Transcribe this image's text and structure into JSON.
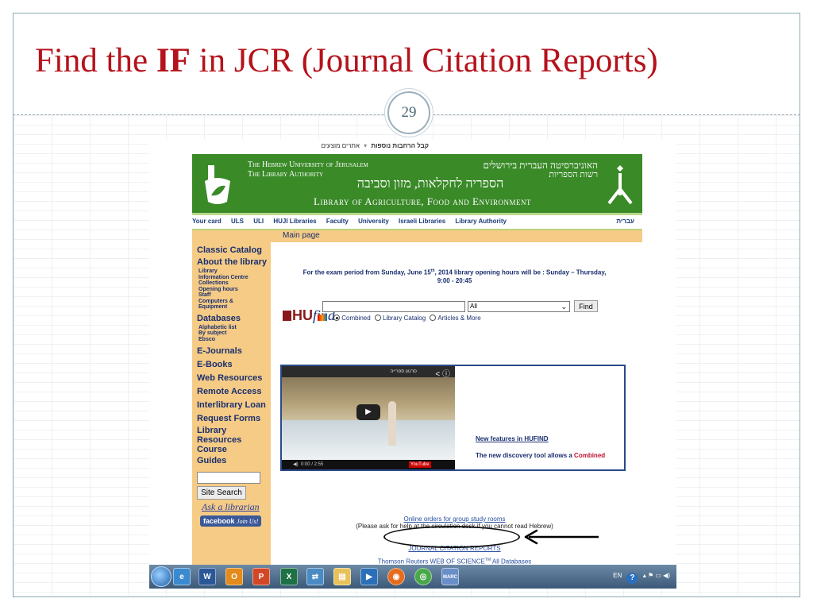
{
  "slide": {
    "title_prefix": "Find the ",
    "title_bold": "IF",
    "title_suffix": " in JCR (Journal Citation Reports)",
    "page_number": "29",
    "accent_color": "#b5121b"
  },
  "browser": {
    "favorites_bar": {
      "item1": "קבל הרחבות נוספות",
      "item2": "אתרים מוצעים"
    }
  },
  "site": {
    "banner": {
      "en_line1": "The Hebrew University of Jerusalem",
      "en_line2": "The Library Authority",
      "he_line1": "האוניברסיטה העברית בירושלים",
      "he_line2": "רשות הספריות",
      "he_line3": "הספריה לחקלאות, מזון וסביבה",
      "en_line3": "Library of Agriculture, Food and Environment",
      "color": "#3a8a28"
    },
    "topnav": {
      "items": [
        "Your card",
        "ULS",
        "ULI",
        "HUJI Libraries",
        "Faculty",
        "University",
        "Israeli Libraries",
        "Library Authority"
      ],
      "hebrew": "עברית"
    },
    "main_header": "Main page",
    "sidebar": {
      "classic_catalog": "Classic Catalog",
      "about": "About the library",
      "about_sub": [
        "Library",
        "Information Centre",
        "Collections",
        "Opening hours",
        "Staff",
        "Computers &",
        "Equipment"
      ],
      "databases": "Databases",
      "databases_sub": [
        "Alphabetic list",
        "By subject",
        "Ebsco"
      ],
      "ejournals": "E-Journals",
      "ebooks": "E-Books",
      "web_resources": "Web Resources",
      "remote_access": "Remote Access",
      "interlibrary_loan": "Interlibrary Loan",
      "request_forms": "Request Forms",
      "library_resources_course": [
        "Library",
        "Resources",
        "Course"
      ],
      "guides": "Guides",
      "site_search": "Site Search",
      "ask_librarian": "Ask a librarian",
      "facebook": "facebook",
      "facebook_join": "Join Us!"
    },
    "notice": {
      "line1_a": "For the exam period from Sunday, June 15",
      "line1_sup": "th",
      "line1_b": ", 2014 library opening hours will be : Sunday – Thursday,",
      "line2": "9:00 - 20:45"
    },
    "hufind": {
      "logo_hu": "HU",
      "logo_find": "find",
      "select_value": "All",
      "find_button": "Find",
      "radio_combined": "Combined",
      "radio_catalog": "Library Catalog",
      "radio_articles": "Articles & More"
    },
    "video": {
      "title": "סרטון ספרייה",
      "time": "0:00 / 2:55",
      "youtube": "YouTube",
      "feature_link": "New features in HUFIND",
      "feature_text": "The new discovery tool allows a ",
      "feature_highlight": "Combined"
    },
    "links": {
      "rooms": "Online orders for group study rooms",
      "rooms_note": "(Please ask for help at the circulation desk if you cannot read Hebrew)",
      "jcr": "JOURNAL CITATION REPORTS",
      "wos_a": "Thomson Reuters WEB OF SCIENCE",
      "wos_sup": "TM",
      "wos_b": " All Databases"
    }
  },
  "taskbar": {
    "icons": [
      "internet-explorer-icon",
      "word-icon",
      "outlook-icon",
      "powerpoint-icon",
      "excel-icon",
      "network-icon",
      "file-explorer-icon",
      "media-player-icon",
      "firefox-icon",
      "chrome-icon",
      "marc-icon"
    ],
    "word_label": "W",
    "outlook_label": "O",
    "ppt_label": "P",
    "excel_label": "X",
    "marc_label": "MARC",
    "lang": "EN"
  }
}
